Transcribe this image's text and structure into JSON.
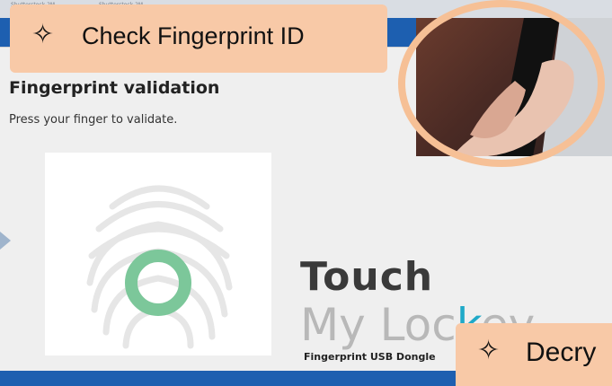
{
  "background_strip": {
    "labels": [
      "Shutterstock 2M",
      "Shutterstock 2M"
    ]
  },
  "dialog": {
    "title": "Fingerprint validation",
    "subtitle": "Press your finger to validate."
  },
  "logo": {
    "line1": "Touch",
    "line2_pre": "My Loc",
    "line2_hl": "k",
    "line2_post": "ey",
    "tagline": "Fingerprint USB Dongle"
  },
  "callouts": {
    "top": {
      "icon": "four-point-star-icon",
      "glyph": "✧",
      "label": "Check Fingerprint ID"
    },
    "bottom": {
      "icon": "four-point-star-icon",
      "glyph": "✧",
      "label": "Decry"
    }
  },
  "colors": {
    "callout_fill": "#f8c9a7",
    "ring": "#f6c096",
    "fingerprint_ring": "#7cc79a",
    "lockey_accent": "#1fa9c8"
  }
}
